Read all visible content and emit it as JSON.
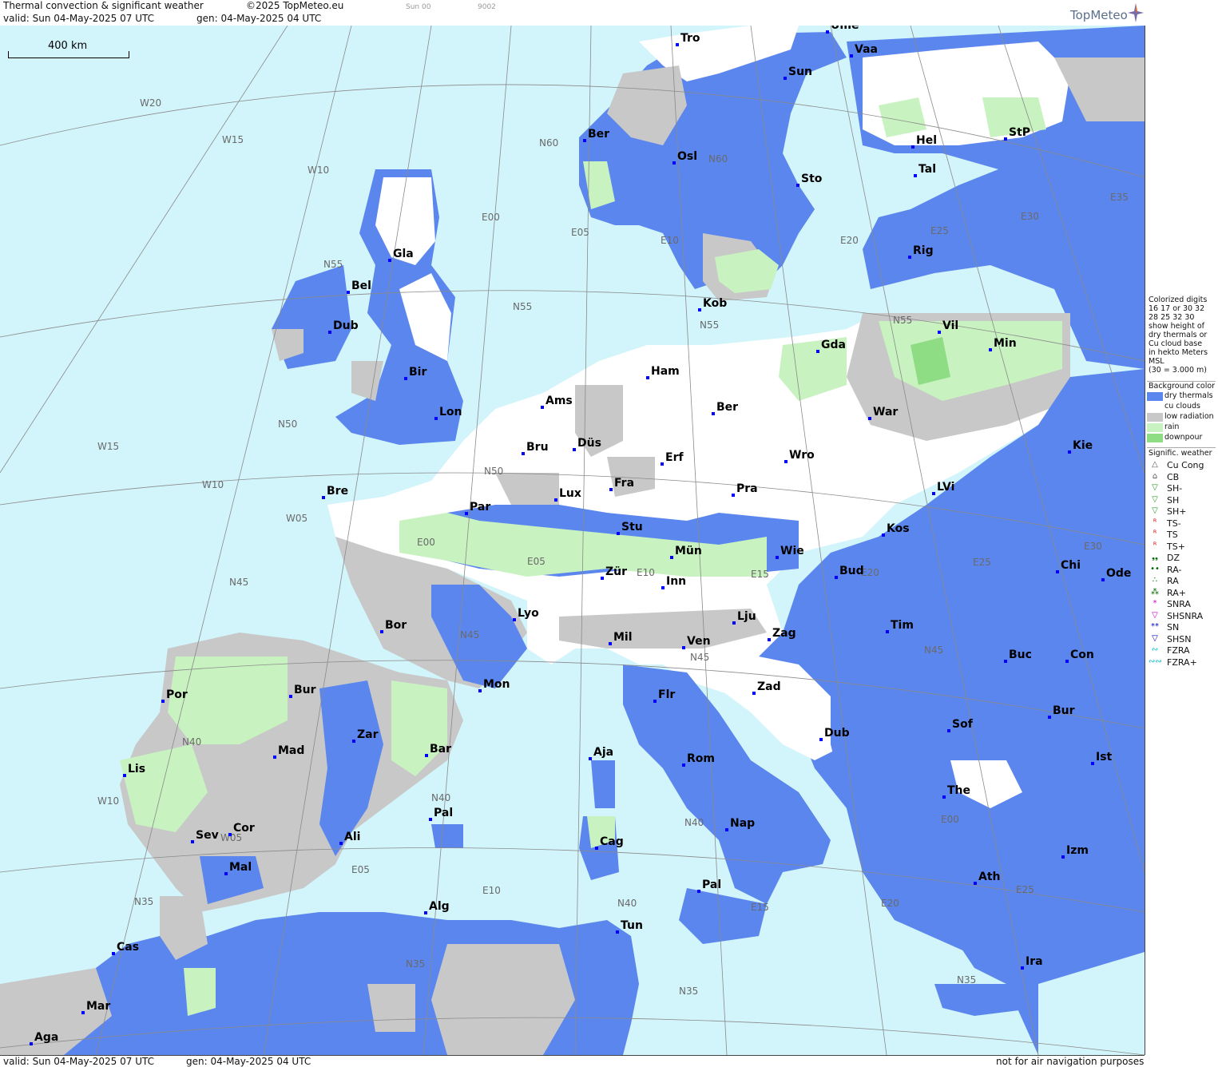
{
  "header": {
    "title": "Thermal convection & significant weather",
    "copyright": "©2025 TopMeteo.eu",
    "valid": "valid:  Sun  04-May-2025  07 UTC",
    "gen": "gen: 04-May-2025 04 UTC",
    "small1": "Sun 00",
    "small2": "9002",
    "logo": "TopMeteo"
  },
  "footer": {
    "valid": "valid:  Sun  04-May-2025  07 UTC",
    "gen": "gen: 04-May-2025 04 UTC",
    "note": "not for air navigation purposes"
  },
  "scale": {
    "label": "400 km"
  },
  "colors": {
    "sea": "#d2f4fb",
    "dry_thermals": "#5b86ee",
    "cu_clouds": "#ffffff",
    "low_radiation": "#c8c8c8",
    "rain": "#c8f2c0",
    "downpour": "#8edc84"
  },
  "legend": {
    "intro": [
      "Colorized digits",
      "16 17  or  30 32",
      "28 25       32 30",
      "show height of",
      "dry thermals or",
      "Cu cloud base",
      "in hekto Meters",
      "MSL",
      "(30 = 3.000 m)"
    ],
    "bg_title": "Background color",
    "bg_items": [
      {
        "label": "dry thermals",
        "color": "#5b86ee"
      },
      {
        "label": "cu clouds",
        "color": "#ffffff"
      },
      {
        "label": "low radiation",
        "color": "#c8c8c8"
      },
      {
        "label": "rain",
        "color": "#c8f2c0"
      },
      {
        "label": "downpour",
        "color": "#8edc84"
      }
    ],
    "wx_title": "Signific. weather",
    "wx_items": [
      {
        "label": "Cu Cong",
        "symbol": "△",
        "color": "#555"
      },
      {
        "label": "CB",
        "symbol": "⌂",
        "color": "#555"
      },
      {
        "label": "SH-",
        "symbol": "▽",
        "color": "#2a9a2a"
      },
      {
        "label": "SH",
        "symbol": "▽",
        "color": "#2a9a2a"
      },
      {
        "label": "SH+",
        "symbol": "▽",
        "color": "#2a9a2a"
      },
      {
        "label": "TS-",
        "symbol": "ᴿ",
        "color": "#d00"
      },
      {
        "label": "TS",
        "symbol": "ᴿ",
        "color": "#d00"
      },
      {
        "label": "TS+",
        "symbol": "ᴿ",
        "color": "#d00"
      },
      {
        "label": "DZ",
        "symbol": "❟❟",
        "color": "#060"
      },
      {
        "label": "RA-",
        "symbol": "••",
        "color": "#060"
      },
      {
        "label": "RA",
        "symbol": "∴",
        "color": "#060"
      },
      {
        "label": "RA+",
        "symbol": "⁂",
        "color": "#060"
      },
      {
        "label": "SNRA",
        "symbol": "*",
        "color": "#c0c"
      },
      {
        "label": "SHSNRA",
        "symbol": "▽",
        "color": "#c0c"
      },
      {
        "label": "SN",
        "symbol": "**",
        "color": "#00c"
      },
      {
        "label": "SHSN",
        "symbol": "▽",
        "color": "#00c"
      },
      {
        "label": "FZRA",
        "symbol": "∾",
        "color": "#0bc"
      },
      {
        "label": "FZRA+",
        "symbol": "∾∾",
        "color": "#0bc"
      }
    ]
  },
  "cities": [
    {
      "name": "Tro"
    },
    {
      "name": "Ume"
    },
    {
      "name": "Vaa"
    },
    {
      "name": "Sun"
    },
    {
      "name": "Ber"
    },
    {
      "name": "Osl"
    },
    {
      "name": "Hel"
    },
    {
      "name": "StP"
    },
    {
      "name": "Tal"
    },
    {
      "name": "Sto"
    },
    {
      "name": "Gla"
    },
    {
      "name": "Bel"
    },
    {
      "name": "Rig"
    },
    {
      "name": "Kob"
    },
    {
      "name": "Dub"
    },
    {
      "name": "Vil"
    },
    {
      "name": "Gda"
    },
    {
      "name": "Min"
    },
    {
      "name": "Bir"
    },
    {
      "name": "Ham"
    },
    {
      "name": "Ams"
    },
    {
      "name": "Lon"
    },
    {
      "name": "Ber"
    },
    {
      "name": "War"
    },
    {
      "name": "Düs"
    },
    {
      "name": "Bru"
    },
    {
      "name": "Erf"
    },
    {
      "name": "Wro"
    },
    {
      "name": "Kie"
    },
    {
      "name": "Bre"
    },
    {
      "name": "Fra"
    },
    {
      "name": "Lux"
    },
    {
      "name": "Par"
    },
    {
      "name": "Pra"
    },
    {
      "name": "LVi"
    },
    {
      "name": "Stu"
    },
    {
      "name": "Kos"
    },
    {
      "name": "Mün"
    },
    {
      "name": "Wie"
    },
    {
      "name": "Bud"
    },
    {
      "name": "Chi"
    },
    {
      "name": "Ode"
    },
    {
      "name": "Zür"
    },
    {
      "name": "Inn"
    },
    {
      "name": "Lyo"
    },
    {
      "name": "Lju"
    },
    {
      "name": "Bor"
    },
    {
      "name": "Tim"
    },
    {
      "name": "Mil"
    },
    {
      "name": "Ven"
    },
    {
      "name": "Zag"
    },
    {
      "name": "Buc"
    },
    {
      "name": "Con"
    },
    {
      "name": "Mon"
    },
    {
      "name": "Flr"
    },
    {
      "name": "Bur"
    },
    {
      "name": "Zad"
    },
    {
      "name": "Por"
    },
    {
      "name": "Bur"
    },
    {
      "name": "Zar"
    },
    {
      "name": "Sof"
    },
    {
      "name": "Dub"
    },
    {
      "name": "Bar"
    },
    {
      "name": "Mad"
    },
    {
      "name": "Aja"
    },
    {
      "name": "Rom"
    },
    {
      "name": "Ist"
    },
    {
      "name": "Lis"
    },
    {
      "name": "Nap"
    },
    {
      "name": "The"
    },
    {
      "name": "Pal"
    },
    {
      "name": "Cor"
    },
    {
      "name": "Cag"
    },
    {
      "name": "Sev"
    },
    {
      "name": "Ali"
    },
    {
      "name": "Izm"
    },
    {
      "name": "Mal"
    },
    {
      "name": "Ath"
    },
    {
      "name": "Pal"
    },
    {
      "name": "Alg"
    },
    {
      "name": "Tun"
    },
    {
      "name": "Cas"
    },
    {
      "name": "Ira"
    },
    {
      "name": "Mar"
    },
    {
      "name": "Aga"
    }
  ],
  "grid_labels": [
    "W20",
    "W15",
    "W10",
    "N60",
    "E00",
    "E05",
    "E10",
    "N60",
    "E20",
    "E30",
    "E35",
    "N55",
    "E25",
    "N55",
    "N55",
    "N55",
    "N50",
    "W15",
    "W10",
    "N50",
    "W05",
    "E00",
    "E05",
    "E10",
    "E15",
    "E20",
    "E25",
    "E30",
    "N45",
    "N45",
    "N45",
    "N45",
    "N40",
    "W10",
    "W05",
    "N40",
    "N40",
    "E00",
    "E05",
    "E10",
    "N40",
    "E15",
    "E20",
    "E25",
    "N35",
    "N35",
    "N35",
    "N35"
  ]
}
